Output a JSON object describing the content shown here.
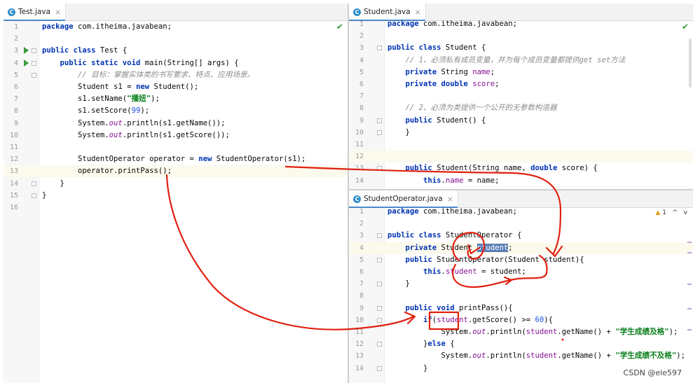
{
  "left_pane": {
    "tab": {
      "icon": "C",
      "label": "Test.java",
      "close": "×"
    },
    "check": "✔",
    "lines": [
      {
        "n": "1",
        "segs": [
          {
            "t": "package",
            "c": "kw"
          },
          {
            "t": " com.itheima.javabean;",
            "c": ""
          }
        ]
      },
      {
        "n": "2",
        "segs": []
      },
      {
        "n": "3",
        "segs": [
          {
            "t": "public class",
            "c": "kw"
          },
          {
            "t": " Test {",
            "c": ""
          }
        ]
      },
      {
        "n": "4",
        "segs": [
          {
            "t": "    "
          },
          {
            "t": "public static void",
            "c": "kw"
          },
          {
            "t": " main(String[] args) {",
            "c": ""
          }
        ]
      },
      {
        "n": "5",
        "segs": [
          {
            "t": "        "
          },
          {
            "t": "// 目标：掌握实体类的书写要求、特点、应用场景。",
            "c": "cm"
          }
        ]
      },
      {
        "n": "6",
        "segs": [
          {
            "t": "        Student s1 = "
          },
          {
            "t": "new",
            "c": "kw"
          },
          {
            "t": " Student();"
          }
        ]
      },
      {
        "n": "7",
        "segs": [
          {
            "t": "        s1.setName("
          },
          {
            "t": "\"播妞\"",
            "c": "str"
          },
          {
            "t": ");"
          }
        ]
      },
      {
        "n": "8",
        "segs": [
          {
            "t": "        s1.setScore("
          },
          {
            "t": "99",
            "c": "num"
          },
          {
            "t": ");"
          }
        ]
      },
      {
        "n": "9",
        "segs": [
          {
            "t": "        System."
          },
          {
            "t": "out",
            "c": "fld it"
          },
          {
            "t": ".println(s1.getName());"
          }
        ]
      },
      {
        "n": "10",
        "segs": [
          {
            "t": "        System."
          },
          {
            "t": "out",
            "c": "fld it"
          },
          {
            "t": ".println(s1.getScore());"
          }
        ]
      },
      {
        "n": "11",
        "segs": []
      },
      {
        "n": "12",
        "segs": [
          {
            "t": "        StudentOperator operator = "
          },
          {
            "t": "new",
            "c": "kw"
          },
          {
            "t": " StudentOperator(s1);"
          }
        ]
      },
      {
        "n": "13",
        "segs": [
          {
            "t": "        operator.printPass();"
          }
        ]
      },
      {
        "n": "14",
        "segs": [
          {
            "t": "    }"
          }
        ]
      },
      {
        "n": "15",
        "segs": [
          {
            "t": "}"
          }
        ]
      },
      {
        "n": "16",
        "segs": []
      }
    ]
  },
  "right_top_pane": {
    "tab": {
      "icon": "C",
      "label": "Student.java",
      "close": "×"
    },
    "check": "✔",
    "lines": [
      {
        "n": "1",
        "segs": [
          {
            "t": "package",
            "c": "kw"
          },
          {
            "t": " com.itheima.javabean;"
          }
        ]
      },
      {
        "n": "2",
        "segs": []
      },
      {
        "n": "3",
        "segs": [
          {
            "t": "public class",
            "c": "kw"
          },
          {
            "t": " Student {"
          }
        ]
      },
      {
        "n": "4",
        "segs": [
          {
            "t": "    "
          },
          {
            "t": "// 1、必须私有成员变量，并为每个成员变量都提供get set方法",
            "c": "cm"
          }
        ]
      },
      {
        "n": "5",
        "segs": [
          {
            "t": "    "
          },
          {
            "t": "private",
            "c": "kw"
          },
          {
            "t": " String "
          },
          {
            "t": "name",
            "c": "fld"
          },
          {
            "t": ";"
          }
        ]
      },
      {
        "n": "6",
        "segs": [
          {
            "t": "    "
          },
          {
            "t": "private double",
            "c": "kw"
          },
          {
            "t": " "
          },
          {
            "t": "score",
            "c": "fld"
          },
          {
            "t": ";"
          }
        ]
      },
      {
        "n": "7",
        "segs": []
      },
      {
        "n": "8",
        "segs": [
          {
            "t": "    "
          },
          {
            "t": "// 2、必须为类提供一个公开的无参数构造器",
            "c": "cm"
          }
        ]
      },
      {
        "n": "9",
        "segs": [
          {
            "t": "    "
          },
          {
            "t": "public",
            "c": "kw"
          },
          {
            "t": " Student() {"
          }
        ]
      },
      {
        "n": "10",
        "segs": [
          {
            "t": "    }"
          }
        ]
      },
      {
        "n": "11",
        "segs": []
      },
      {
        "n": "12",
        "segs": []
      },
      {
        "n": "13",
        "segs": [
          {
            "t": "    "
          },
          {
            "t": "public",
            "c": "kw"
          },
          {
            "t": " Student(String name, "
          },
          {
            "t": "double",
            "c": "kw"
          },
          {
            "t": " score) {"
          }
        ]
      },
      {
        "n": "14",
        "segs": [
          {
            "t": "        "
          },
          {
            "t": "this",
            "c": "kw"
          },
          {
            "t": "."
          },
          {
            "t": "name",
            "c": "fld"
          },
          {
            "t": " = name;"
          }
        ]
      }
    ]
  },
  "right_bottom_pane": {
    "tab": {
      "icon": "C",
      "label": "StudentOperator.java",
      "close": "×"
    },
    "warning": {
      "symbol": "▲",
      "count": "1"
    },
    "nav": {
      "up": "^",
      "down": "v"
    },
    "lines": [
      {
        "n": "1",
        "segs": [
          {
            "t": "package",
            "c": "kw"
          },
          {
            "t": " com.itheima.javabean;"
          }
        ]
      },
      {
        "n": "2",
        "segs": []
      },
      {
        "n": "3",
        "segs": [
          {
            "t": "public class",
            "c": "kw"
          },
          {
            "t": " StudentOperator {"
          }
        ]
      },
      {
        "n": "4",
        "segs": [
          {
            "t": "    "
          },
          {
            "t": "private",
            "c": "kw"
          },
          {
            "t": " Student "
          },
          {
            "t": "student",
            "c": "sel"
          },
          {
            "t": ";"
          }
        ]
      },
      {
        "n": "5",
        "segs": [
          {
            "t": "    "
          },
          {
            "t": "public",
            "c": "kw"
          },
          {
            "t": " StudentOperator(Student student){"
          }
        ]
      },
      {
        "n": "6",
        "segs": [
          {
            "t": "        "
          },
          {
            "t": "this",
            "c": "kw"
          },
          {
            "t": "."
          },
          {
            "t": "student",
            "c": "fld"
          },
          {
            "t": " = student;"
          }
        ]
      },
      {
        "n": "7",
        "segs": [
          {
            "t": "    }"
          }
        ]
      },
      {
        "n": "8",
        "segs": []
      },
      {
        "n": "9",
        "segs": [
          {
            "t": "    "
          },
          {
            "t": "public void",
            "c": "kw"
          },
          {
            "t": " printPass(){"
          }
        ]
      },
      {
        "n": "10",
        "segs": [
          {
            "t": "        "
          },
          {
            "t": "if",
            "c": "kw"
          },
          {
            "t": "("
          },
          {
            "t": "student",
            "c": "fld"
          },
          {
            "t": ".getScore() >= "
          },
          {
            "t": "60",
            "c": "num"
          },
          {
            "t": "){"
          }
        ]
      },
      {
        "n": "11",
        "segs": [
          {
            "t": "            System."
          },
          {
            "t": "out",
            "c": "fld it"
          },
          {
            "t": ".println("
          },
          {
            "t": "student",
            "c": "fld"
          },
          {
            "t": ".getName() + "
          },
          {
            "t": "\"学生成绩及格\"",
            "c": "str"
          },
          {
            "t": ");"
          }
        ]
      },
      {
        "n": "12",
        "segs": [
          {
            "t": "        }"
          },
          {
            "t": "else",
            "c": "kw"
          },
          {
            "t": " {"
          }
        ]
      },
      {
        "n": "13",
        "segs": [
          {
            "t": "            System."
          },
          {
            "t": "out",
            "c": "fld it"
          },
          {
            "t": ".println("
          },
          {
            "t": "student",
            "c": "fld"
          },
          {
            "t": ".getName() + "
          },
          {
            "t": "\"学生成绩不及格\"",
            "c": "str"
          },
          {
            "t": ");"
          }
        ]
      },
      {
        "n": "14",
        "segs": [
          {
            "t": "        }"
          }
        ]
      }
    ]
  },
  "watermark": "CSDN @ele597",
  "colors": {
    "annotation": "#e02010",
    "caret_line": "#fcfaed",
    "selection": "#5a7eb8"
  }
}
